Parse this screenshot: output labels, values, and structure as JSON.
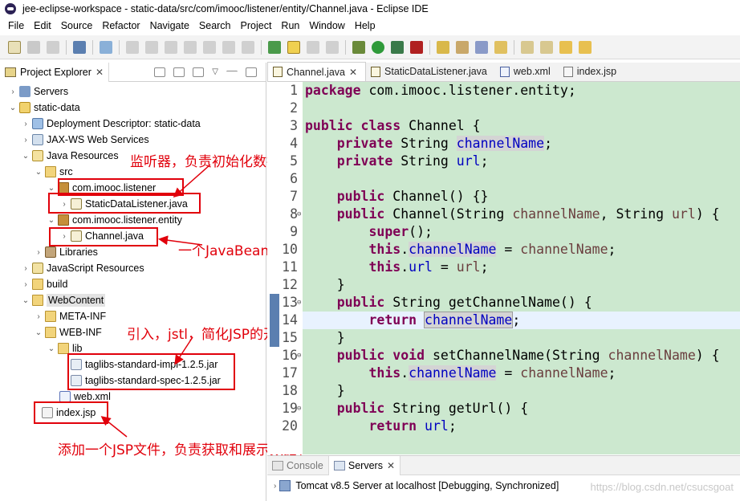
{
  "window": {
    "title": "jee-eclipse-workspace - static-data/src/com/imooc/listener/entity/Channel.java - Eclipse IDE"
  },
  "menu": [
    "File",
    "Edit",
    "Source",
    "Refactor",
    "Navigate",
    "Search",
    "Project",
    "Run",
    "Window",
    "Help"
  ],
  "project_explorer": {
    "title": "Project Explorer",
    "items": [
      {
        "label": "Servers"
      },
      {
        "label": "static-data"
      },
      {
        "label": "Deployment Descriptor: static-data"
      },
      {
        "label": "JAX-WS Web Services"
      },
      {
        "label": "Java Resources"
      },
      {
        "label": "src"
      },
      {
        "label": "com.imooc.listener"
      },
      {
        "label": "StaticDataListener.java"
      },
      {
        "label": "com.imooc.listener.entity"
      },
      {
        "label": "Channel.java"
      },
      {
        "label": "Libraries"
      },
      {
        "label": "JavaScript Resources"
      },
      {
        "label": "build"
      },
      {
        "label": "WebContent"
      },
      {
        "label": "META-INF"
      },
      {
        "label": "WEB-INF"
      },
      {
        "label": "lib"
      },
      {
        "label": "taglibs-standard-impl-1.2.5.jar"
      },
      {
        "label": "taglibs-standard-spec-1.2.5.jar"
      },
      {
        "label": "web.xml"
      },
      {
        "label": "index.jsp"
      }
    ]
  },
  "annotations": {
    "listener": "监听器，负责初始化数据；",
    "javabean": "一个JavaBean；",
    "jstl": "引入，jstl，简化JSP的开发；",
    "jsp": "添加一个JSP文件，负责获取和展示数据；"
  },
  "editor": {
    "tabs": [
      "Channel.java",
      "StaticDataListener.java",
      "web.xml",
      "index.jsp"
    ],
    "lines": [
      "1",
      "2",
      "3",
      "4",
      "5",
      "6",
      "7",
      "8",
      "9",
      "10",
      "11",
      "12",
      "13",
      "14",
      "15",
      "16",
      "17",
      "18",
      "19",
      "20"
    ],
    "code": {
      "l1_kw": "package",
      "l1_rest": " com.imooc.listener.entity;",
      "l4_kw": "public class",
      "l4_rest": " Channel {",
      "l5_kw": "private",
      "l5_type": " String ",
      "l5_field": "channelName",
      "l5_end": ";",
      "l6_kw": "private",
      "l6_type": " String ",
      "l6_field": "url",
      "l6_end": ";",
      "l8_kw": "public",
      "l8_rest": " Channel() {}",
      "l9_kw": "public",
      "l9_a": " Channel(String ",
      "l9_p1": "channelName",
      "l9_b": ", String ",
      "l9_p2": "url",
      "l9_c": ") {",
      "l10_kw": "super",
      "l10_rest": "();",
      "l11_kw": "this",
      "l11_dot": ".",
      "l11_field": "channelName",
      "l11_eq": " = ",
      "l11_param": "channelName",
      "l11_end": ";",
      "l12_kw": "this",
      "l12_dot": ".",
      "l12_field": "url",
      "l12_eq": " = ",
      "l12_param": "url",
      "l12_end": ";",
      "l13_rest": "}",
      "l14_kw": "public",
      "l14_rest": " String getChannelName() {",
      "l15_kw": "return",
      "l15_sp": " ",
      "l15_field": "channelName",
      "l15_end": ";",
      "l16_rest": "}",
      "l17_kw": "public void",
      "l17_a": " setChannelName(String ",
      "l17_param": "channelName",
      "l17_b": ") {",
      "l18_kw": "this",
      "l18_dot": ".",
      "l18_field": "channelName",
      "l18_eq": " = ",
      "l18_param": "channelName",
      "l18_end": ";",
      "l19_rest": "}",
      "l20_kw": "public",
      "l20_rest": " String getUrl() {",
      "l21_kw": "return",
      "l21_sp": " ",
      "l21_field": "url",
      "l21_end": ";"
    }
  },
  "bottom_panel": {
    "tabs": [
      "Console",
      "Servers"
    ],
    "server_row": "Tomcat v8.5 Server at localhost  [Debugging, Synchronized]",
    "watermark": "https://blog.csdn.net/csucsgoat"
  },
  "colors": {
    "annotation_red": "#e1000b",
    "code_background": "#cce8cf",
    "keyword": "#7f0055",
    "field": "#0000c0",
    "parameter": "#6a3e3e"
  }
}
